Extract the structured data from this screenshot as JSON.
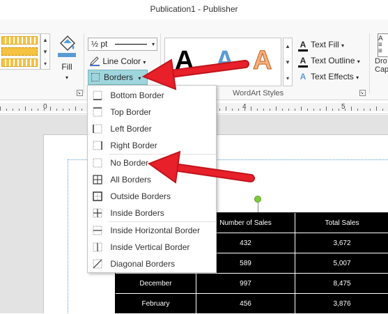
{
  "window": {
    "title": "Publication1 - Publisher"
  },
  "ribbon": {
    "fill_label": "Fill",
    "weight_value": "½ pt",
    "line_color_label": "Line Color",
    "borders_label": "Borders",
    "wordart_letters": [
      "A",
      "A",
      "A"
    ],
    "wordart_group_label": "WordArt Styles",
    "text_fill_label": "Text Fill",
    "text_outline_label": "Text Outline",
    "text_effects_label": "Text Effects",
    "drop_cap_label_1": "Dro",
    "drop_cap_label_2": "Cap"
  },
  "ruler": {
    "labels": [
      "0",
      "4",
      "5"
    ]
  },
  "borders_menu": {
    "items": [
      {
        "label": "Bottom Border",
        "icon": "bottom-border-icon"
      },
      {
        "label": "Top Border",
        "icon": "top-border-icon"
      },
      {
        "label": "Left Border",
        "icon": "left-border-icon"
      },
      {
        "label": "Right Border",
        "icon": "right-border-icon"
      },
      {
        "label": "No Border",
        "icon": "no-border-icon"
      },
      {
        "label": "All Borders",
        "icon": "all-borders-icon"
      },
      {
        "label": "Outside Borders",
        "icon": "outside-borders-icon"
      },
      {
        "label": "Inside Borders",
        "icon": "inside-borders-icon"
      },
      {
        "label": "Inside Horizontal Border",
        "icon": "inside-horizontal-border-icon"
      },
      {
        "label": "Inside Vertical Border",
        "icon": "inside-vertical-border-icon"
      },
      {
        "label": "Diagonal Borders",
        "icon": "diagonal-borders-icon"
      }
    ]
  },
  "table": {
    "headers": [
      "",
      "Number of Sales",
      "Total Sales"
    ],
    "rows": [
      [
        "",
        "432",
        "3,672"
      ],
      [
        "",
        "589",
        "5,007"
      ],
      [
        "December",
        "997",
        "8,475"
      ],
      [
        "February",
        "456",
        "3,876"
      ]
    ]
  },
  "colors": {
    "accent_highlight": "#9fd6dd",
    "annotation_arrow": "#e8202a",
    "table_background": "#000000"
  }
}
